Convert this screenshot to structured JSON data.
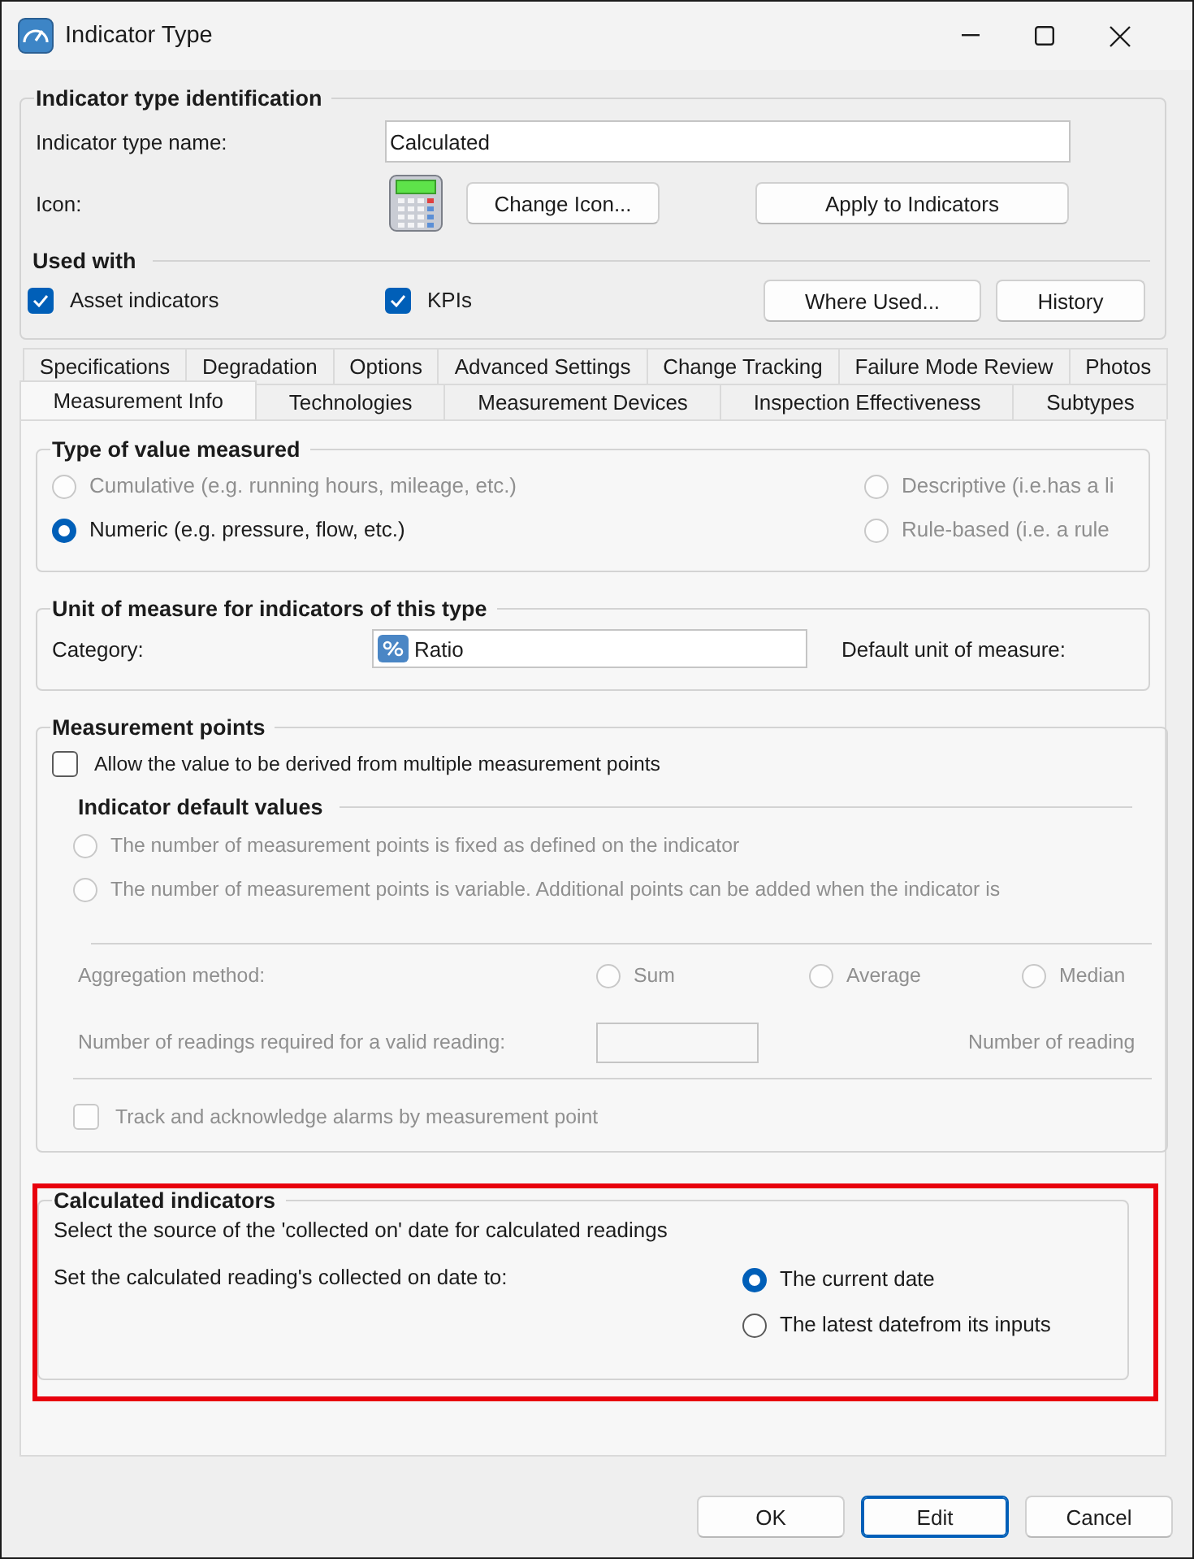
{
  "window": {
    "title": "Indicator Type"
  },
  "identification": {
    "title": "Indicator type identification",
    "name_label": "Indicator type name:",
    "name_value": "Calculated",
    "icon_label": "Icon:",
    "change_icon_button": "Change Icon...",
    "apply_button": "Apply to Indicators"
  },
  "used_with": {
    "title": "Used with",
    "options": [
      {
        "label": "Asset indicators",
        "checked": true
      },
      {
        "label": "KPIs",
        "checked": true
      }
    ],
    "where_used_button": "Where Used...",
    "history_button": "History"
  },
  "tab_rows": [
    {
      "tabs": [
        {
          "label": "Specifications",
          "selected": false
        },
        {
          "label": "Degradation",
          "selected": false
        },
        {
          "label": "Options",
          "selected": false
        },
        {
          "label": "Advanced Settings",
          "selected": false
        },
        {
          "label": "Change Tracking",
          "selected": false
        },
        {
          "label": "Failure Mode Review",
          "selected": false
        },
        {
          "label": "Photos",
          "selected": false
        }
      ]
    },
    {
      "tabs": [
        {
          "label": "Measurement Info",
          "selected": true
        },
        {
          "label": "Technologies",
          "selected": false
        },
        {
          "label": "Measurement Devices",
          "selected": false
        },
        {
          "label": "Inspection Effectiveness",
          "selected": false
        },
        {
          "label": "Subtypes",
          "selected": false
        }
      ]
    }
  ],
  "value_type": {
    "title": "Type of value measured",
    "options": [
      {
        "label": "Cumulative (e.g. running hours, mileage, etc.)",
        "selected": false,
        "disabled": true
      },
      {
        "label": "Descriptive (i.e.has a li",
        "selected": false,
        "disabled": true
      },
      {
        "label": "Numeric (e.g. pressure, flow, etc.)",
        "selected": true,
        "disabled": false
      },
      {
        "label": "Rule-based (i.e. a rule",
        "selected": false,
        "disabled": true
      }
    ]
  },
  "unit": {
    "title": "Unit of measure for indicators of this type",
    "category_label": "Category:",
    "category_value": "Ratio",
    "default_label": "Default unit of measure:"
  },
  "measurement_points": {
    "title": "Measurement points",
    "allow": {
      "label": "Allow the value to be derived from multiple measurement points",
      "checked": false
    },
    "details_disabled": true,
    "defaults_title": "Indicator default values",
    "count_options": [
      {
        "label": "The number of measurement points is fixed as defined on the indicator",
        "selected": false,
        "disabled": true
      },
      {
        "label": "The number of measurement points is variable.  Additional points can be added when the indicator is",
        "selected": false,
        "disabled": true
      }
    ],
    "aggregation_label": "Aggregation method:",
    "aggregation_options": [
      {
        "label": "Sum",
        "selected": false,
        "disabled": true
      },
      {
        "label": "Average",
        "selected": false,
        "disabled": true
      },
      {
        "label": "Median",
        "selected": false,
        "disabled": true
      }
    ],
    "readings_label": "Number of readings required for a valid reading:",
    "readings_right_label": "Number of reading",
    "track": {
      "label": "Track and acknowledge alarms by measurement point",
      "checked": false,
      "disabled": true
    }
  },
  "calculated": {
    "title": "Calculated indicators",
    "highlighted": true,
    "description": "Select the source of the 'collected on' date for calculated readings",
    "date_label": "Set the calculated reading's collected on date to:",
    "date_options": [
      {
        "label": "The current date",
        "selected": true
      },
      {
        "label": "The latest datefrom its inputs",
        "selected": false
      }
    ]
  },
  "footer_buttons": [
    {
      "label": "OK",
      "default": false
    },
    {
      "label": "Edit",
      "default": true
    },
    {
      "label": "Cancel",
      "default": false
    }
  ]
}
